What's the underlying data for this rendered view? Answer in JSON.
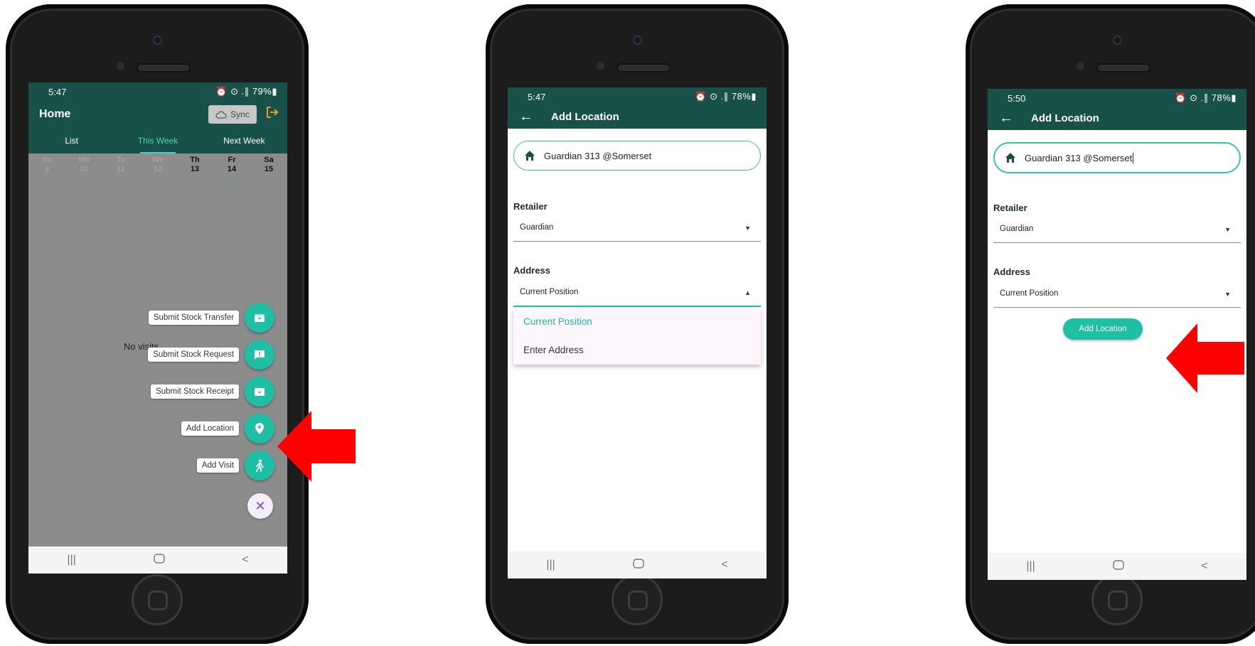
{
  "screen1": {
    "status": {
      "time": "5:47",
      "icons": "⏰ ⊙ .∥ 79%▮"
    },
    "title": "Home",
    "sync_label": "Sync",
    "tabs": [
      "List",
      "This Week",
      "Next Week"
    ],
    "days": [
      {
        "name": "Su",
        "num": "9"
      },
      {
        "name": "Mo",
        "num": "10"
      },
      {
        "name": "Tu",
        "num": "11"
      },
      {
        "name": "We",
        "num": "12"
      },
      {
        "name": "Th",
        "num": "13"
      },
      {
        "name": "Fr",
        "num": "14"
      },
      {
        "name": "Sa",
        "num": "15"
      }
    ],
    "empty_text": "No visits",
    "actions": [
      {
        "label": "Submit Stock Transfer",
        "icon": "box-icon"
      },
      {
        "label": "Submit Stock Request",
        "icon": "comment-alert-icon"
      },
      {
        "label": "Submit Stock Receipt",
        "icon": "box-icon"
      },
      {
        "label": "Add Location",
        "icon": "location-add-icon"
      },
      {
        "label": "Add Visit",
        "icon": "walk-icon"
      }
    ]
  },
  "screen2": {
    "status": {
      "time": "5:47",
      "icons": "⏰ ⊙ .∥ 78%▮"
    },
    "title": "Add Location",
    "location_name": "Guardian 313 @Somerset",
    "retailer_label": "Retailer",
    "retailer_value": "Guardian",
    "address_label": "Address",
    "address_value": "Current Position",
    "address_options": [
      "Current Position",
      "Enter Address"
    ]
  },
  "screen3": {
    "status": {
      "time": "5:50",
      "icons": "⏰ ⊙ .∥ 78%▮"
    },
    "title": "Add Location",
    "location_name": "Guardian 313 @Somerset",
    "retailer_label": "Retailer",
    "retailer_value": "Guardian",
    "address_label": "Address",
    "address_value": "Current Position",
    "submit_label": "Add Location"
  },
  "nav_icons": [
    "recent-apps-icon",
    "home-icon",
    "back-icon"
  ],
  "colors": {
    "appbar": "#17514a",
    "accent": "#1fbfa5",
    "arrow": "#ff0000"
  }
}
